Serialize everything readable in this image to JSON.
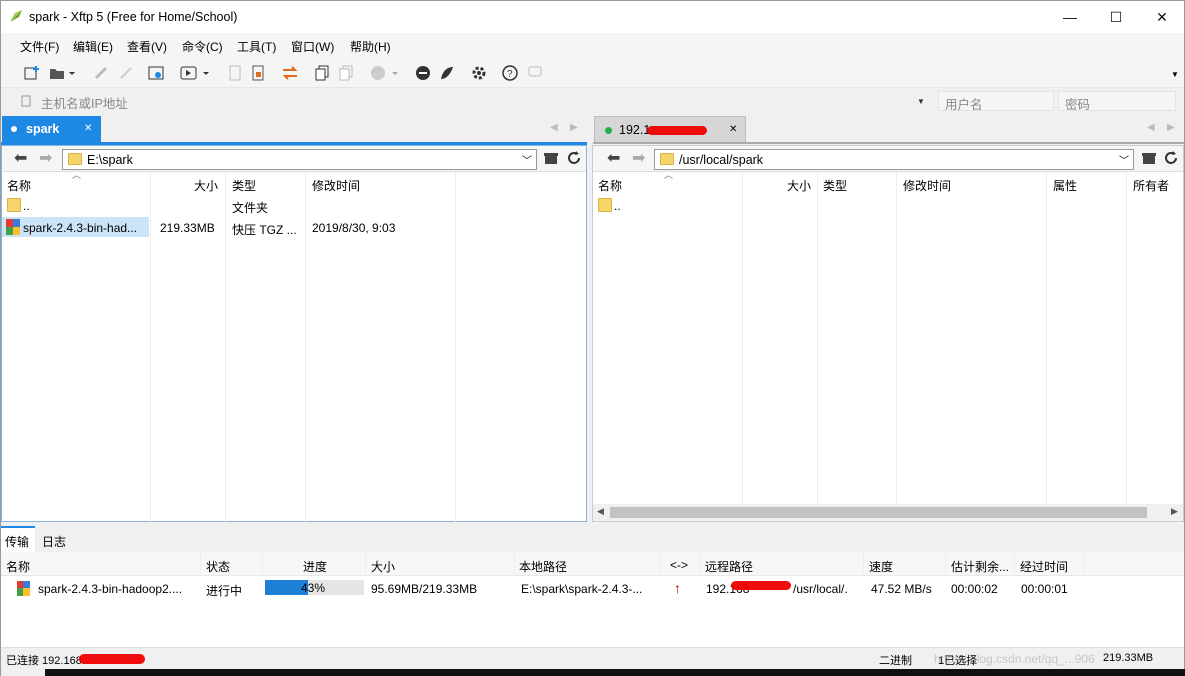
{
  "window": {
    "title": "spark - Xftp 5 (Free for Home/School)",
    "controls": {
      "minimize": "—",
      "maximize": "☐",
      "close": "✕"
    }
  },
  "menu": [
    "文件(F)",
    "编辑(E)",
    "查看(V)",
    "命令(C)",
    "工具(T)",
    "窗口(W)",
    "帮助(H)"
  ],
  "address": {
    "host_placeholder": "主机名或IP地址",
    "user_placeholder": "用户名",
    "password_placeholder": "密码"
  },
  "local": {
    "tab_label": "spark",
    "path": "E:\\spark",
    "columns": [
      "名称",
      "大小",
      "类型",
      "修改时间"
    ],
    "rows": [
      {
        "name": "..",
        "size": "",
        "type": "文件夹",
        "modified": ""
      },
      {
        "name": "spark-2.4.3-bin-had...",
        "size": "219.33MB",
        "type": "快压 TGZ ...",
        "modified": "2019/8/30, 9:03"
      }
    ]
  },
  "remote": {
    "tab_label": "192.1",
    "path": "/usr/local/spark",
    "columns": [
      "名称",
      "大小",
      "类型",
      "修改时间",
      "属性",
      "所有者"
    ],
    "rows": [
      {
        "name": ".."
      }
    ]
  },
  "bottom_tabs": [
    "传输",
    "日志"
  ],
  "transfer": {
    "columns": [
      "名称",
      "状态",
      "进度",
      "大小",
      "本地路径",
      "<->",
      "远程路径",
      "速度",
      "估计剩余...",
      "经过时间"
    ],
    "row": {
      "name": "spark-2.4.3-bin-hadoop2....",
      "status": "进行中",
      "progress": 0.43,
      "progress_label": "43%",
      "size": "95.69MB/219.33MB",
      "local_path": "E:\\spark\\spark-2.4.3-...",
      "direction": "↑",
      "remote_path_prefix": "192.168",
      "remote_path_suffix": "/usr/local/.",
      "speed": "47.52 MB/s",
      "remaining": "00:00:02",
      "elapsed": "00:00:01"
    }
  },
  "status": {
    "connected": "已连接 192.168.",
    "mode": "二进制",
    "transfers": "1已选择",
    "size": "219.33MB",
    "watermark": "https://blog.csdn.net/qq_...906"
  },
  "colors": {
    "accent": "#1e88e5",
    "progress": "#1e7fd6",
    "redact": "#e00000",
    "upload_arrow": "#cc0000"
  }
}
